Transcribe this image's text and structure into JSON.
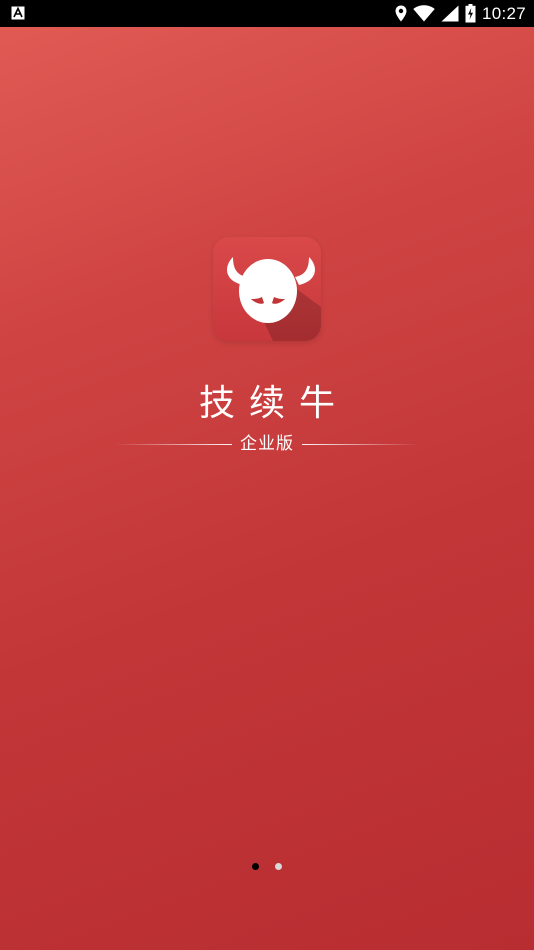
{
  "status_bar": {
    "time": "10:27",
    "icons": [
      "notification-a-icon",
      "location-icon",
      "wifi-icon",
      "signal-icon",
      "battery-charging-icon"
    ]
  },
  "app": {
    "title": "技续牛",
    "subtitle": "企业版",
    "logo_icon": "bull-head-logo-icon"
  },
  "pager": {
    "page_count": 2,
    "current_page": 1
  },
  "colors": {
    "background_top": "#e25c55",
    "background_bottom": "#b82d31",
    "logo_bg": "#cf3f41",
    "text": "#ffffff",
    "dot_active": "#000000",
    "dot_inactive": "#d9d9d9"
  }
}
